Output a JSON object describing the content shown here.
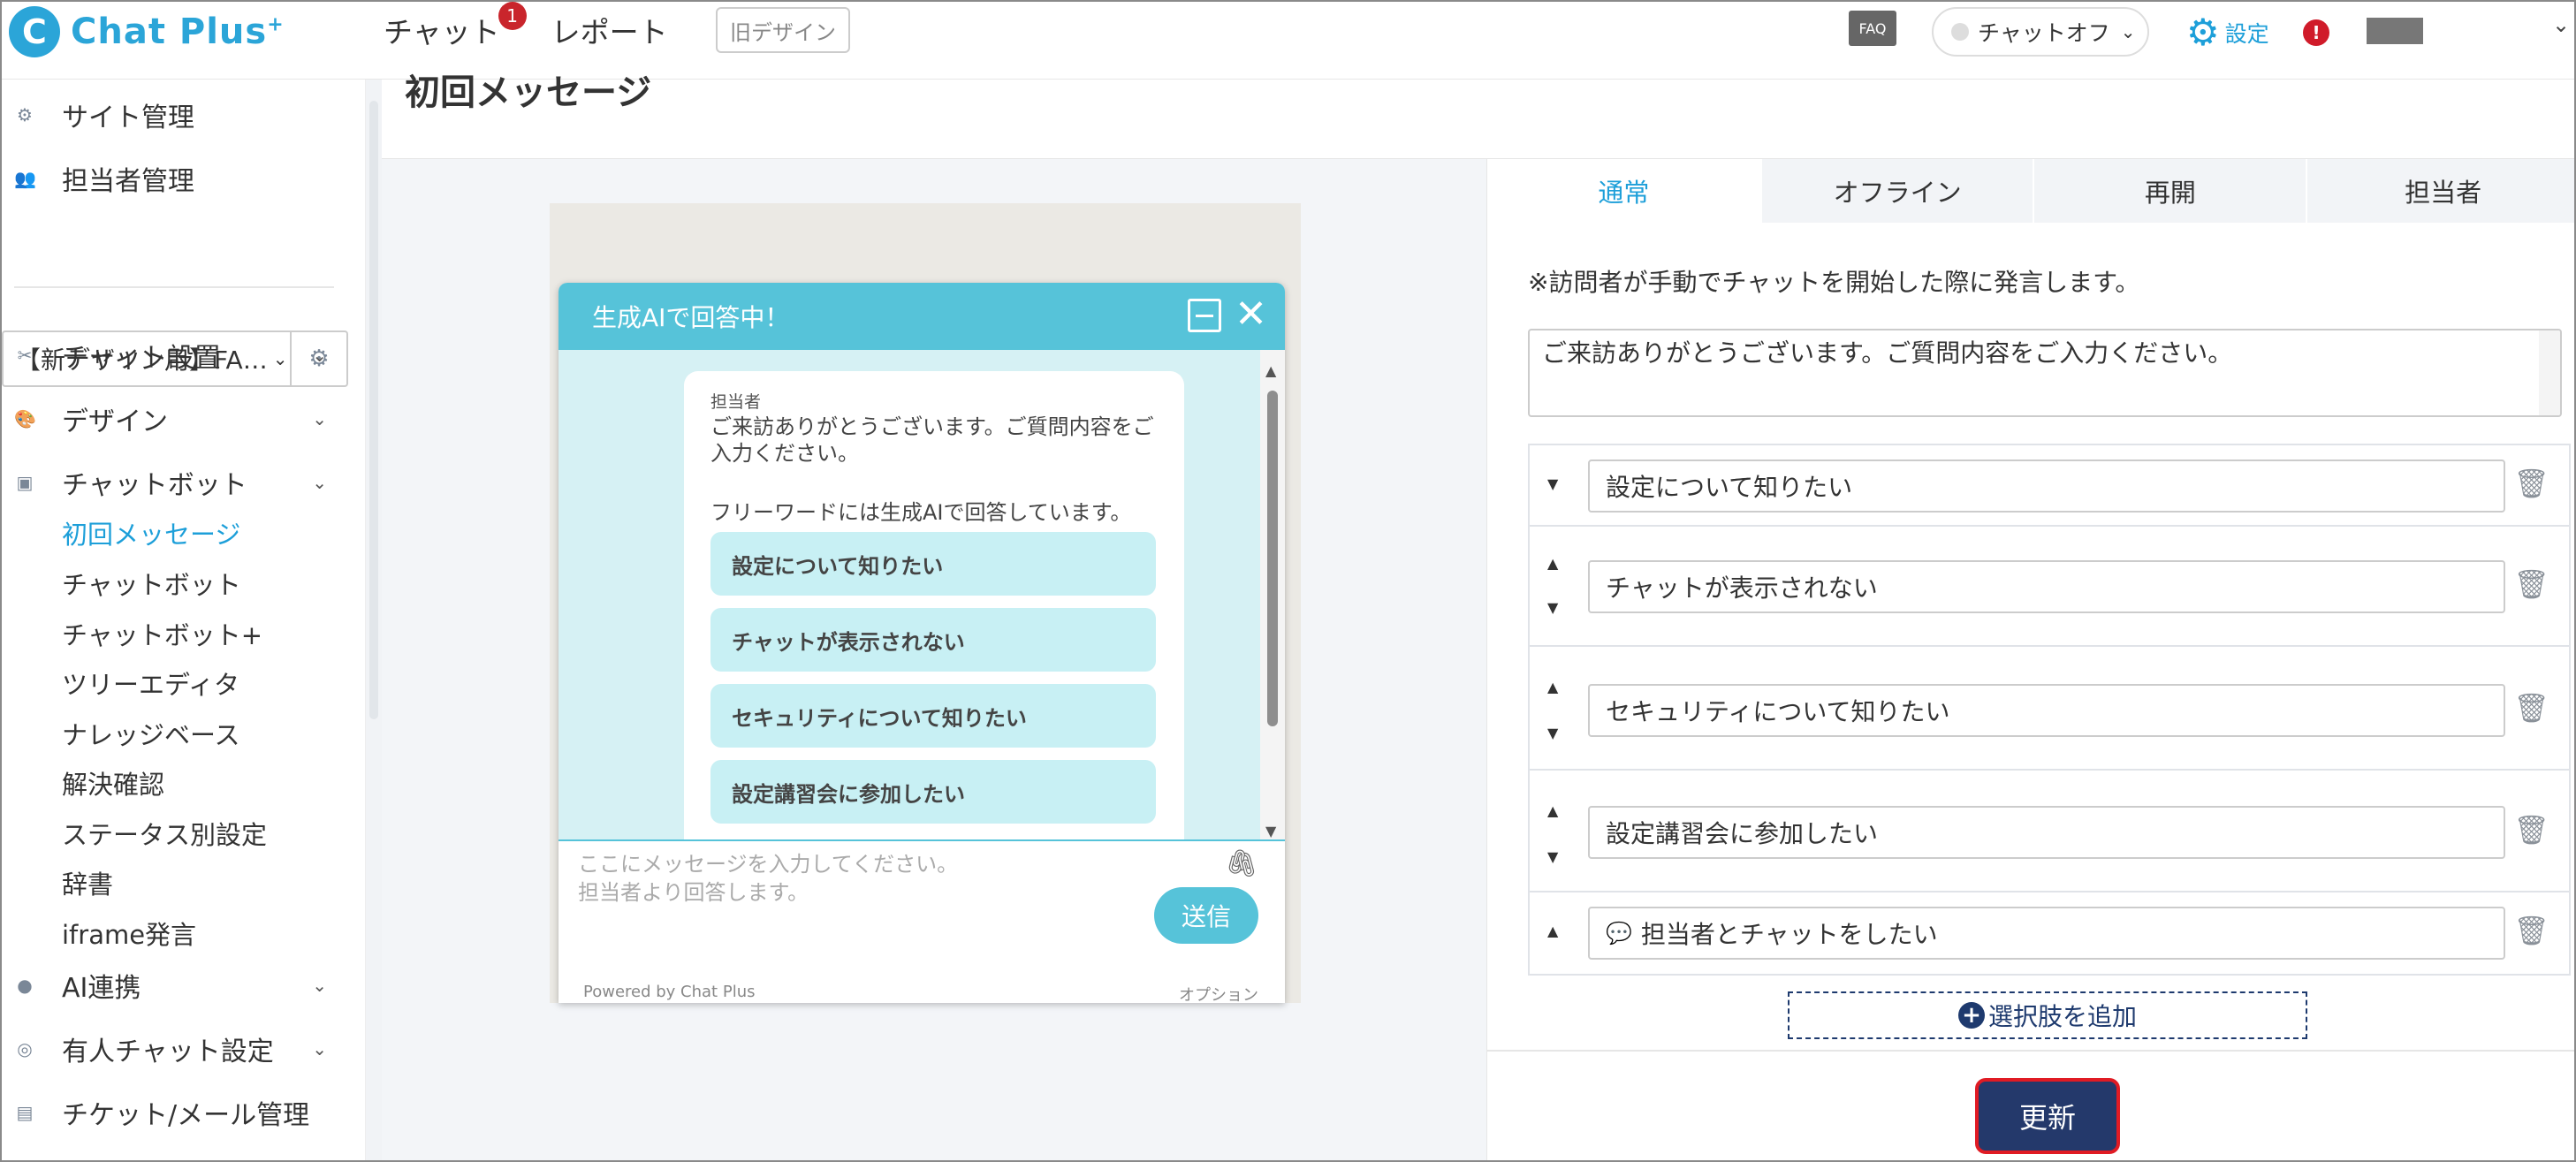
{
  "header": {
    "logo_mark": "C",
    "logo_text": "Chat Plus",
    "logo_sup": "+",
    "nav": [
      {
        "label": "チャット",
        "badge": "1"
      },
      {
        "label": "レポート"
      }
    ],
    "old_design": "旧デザイン",
    "faq": "FAQ",
    "chat_status": "チャットオフ",
    "settings": "設定",
    "alert": "!"
  },
  "sidebar": {
    "top_items": [
      {
        "icon": "gear-icon",
        "label": "サイト管理"
      },
      {
        "icon": "users-icon",
        "label": "担当者管理"
      }
    ],
    "site_select": "【新デザイン用】FA…",
    "sections": [
      {
        "icon": "tools-icon",
        "label": "チャット設置"
      },
      {
        "icon": "palette-icon",
        "label": "デザイン"
      },
      {
        "icon": "chat-icon",
        "label": "チャットボット"
      }
    ],
    "sub_items": [
      "初回メッセージ",
      "チャットボット",
      "チャットボット+",
      "ツリーエディタ",
      "ナレッジベース",
      "解決確認",
      "ステータス別設定",
      "辞書",
      "iframe発言"
    ],
    "active_sub": "初回メッセージ",
    "bottom_sections": [
      {
        "icon": "bulb-icon",
        "label": "AI連携"
      },
      {
        "icon": "headset-icon",
        "label": "有人チャット設定"
      },
      {
        "icon": "ticket-icon",
        "label": "チケット/メール管理"
      }
    ]
  },
  "main": {
    "page_title": "初回メッセージ"
  },
  "widget": {
    "title": "生成AIで回答中！",
    "sender": "担当者",
    "message": "ご来訪ありがとうございます。ご質問内容をご入力ください。",
    "message2": "フリーワードには生成AIで回答しています。",
    "options": [
      "設定について知りたい",
      "チャットが表示されない",
      "セキュリティについて知りたい",
      "設定講習会に参加したい"
    ],
    "placeholder_line1": "ここにメッセージを入力してください。",
    "placeholder_line2": "担当者より回答します。",
    "send": "送信",
    "powered": "Powered by Chat Plus",
    "option_link": "オプション"
  },
  "panel": {
    "tabs": [
      "通常",
      "オフライン",
      "再開",
      "担当者"
    ],
    "active_tab": "通常",
    "notice": "※訪問者が手動でチャットを開始した際に発言します。",
    "message_text": "ご来訪ありがとうございます。ご質問内容をご入力ください。",
    "choices": [
      "設定について知りたい",
      "チャットが表示されない",
      "セキュリティについて知りたい",
      "設定講習会に参加したい",
      "担当者とチャットをしたい"
    ],
    "add_choice": "選択肢を追加",
    "update": "更新"
  }
}
